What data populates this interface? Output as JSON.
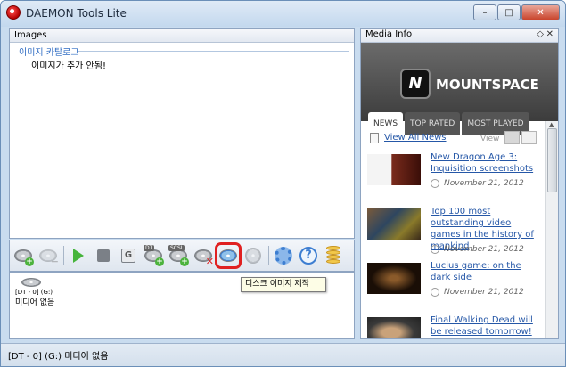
{
  "window": {
    "title": "DAEMON Tools Lite",
    "controls": [
      "–",
      "□",
      "✕"
    ]
  },
  "images_panel": {
    "header": "Images",
    "catalog_title": "이미지 카탈로그",
    "catalog_empty": "이미지가 추가 안됨!"
  },
  "toolbar": {
    "dt_tag": "DT",
    "scsi_tag": "SCSI",
    "g_label": "G",
    "help_label": "?"
  },
  "tooltip": "디스크 이미지 제작",
  "devices": {
    "device_label": "[DT - 0] (G:)",
    "device_status": "미디어 없음"
  },
  "media_info": {
    "header": "Media Info",
    "brand": "MOUNTSPACE",
    "logo_glyph": "N",
    "tabs": [
      "NEWS",
      "TOP RATED",
      "MOST PLAYED"
    ],
    "active_tab": "NEWS",
    "view_all": "View All News",
    "view_label": "View",
    "news": [
      {
        "title": "New Dragon Age 3: Inquisition screenshots",
        "date": "November 21, 2012"
      },
      {
        "title": "Top 100 most outstanding video games in the history of mankind",
        "date": "November 21, 2012"
      },
      {
        "title": "Lucius game: on the dark side",
        "date": "November 21, 2012"
      },
      {
        "title": "Final Walking Dead will be released tomorrow!",
        "date": ""
      }
    ],
    "thumb_colors": [
      "#6a2218",
      "#3a5a7a",
      "#2a1a10",
      "#5c5c5c"
    ]
  },
  "statusbar": {
    "text": "[DT - 0] (G:) 미디어 없음"
  }
}
